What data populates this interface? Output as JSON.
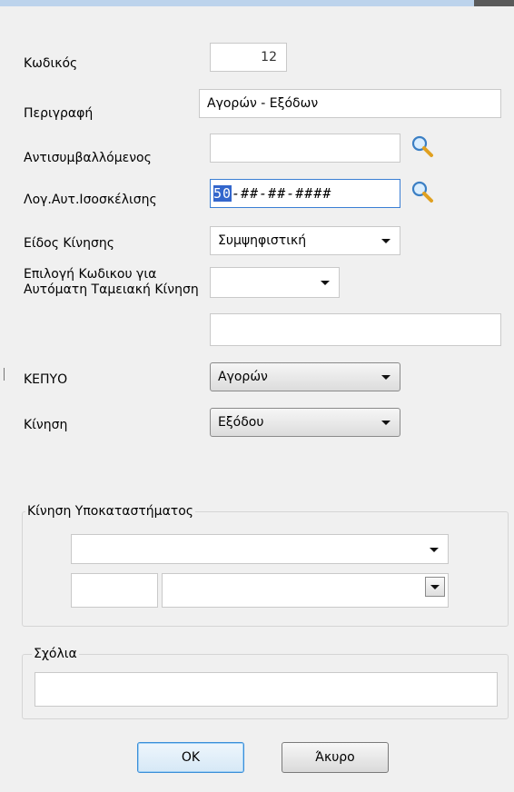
{
  "form": {
    "code_label": "Κωδικός",
    "code_value": "12",
    "description_label": "Περιγραφή",
    "description_value": "Αγορών - Εξόδων",
    "counterparty_label": "Αντισυμβαλλόμενος",
    "counterparty_value": "",
    "balance_account_label": "Λογ.Αυτ.Ισοσκέλισης",
    "balance_account_selected": "50",
    "balance_account_mask": "-##-##-####",
    "movement_type_label": "Είδος Κίνησης",
    "movement_type_value": "Συμψηφιστική",
    "auto_cash_label": "Επιλογή Κωδικου για Αυτόματη Ταμειακή Κίνηση",
    "auto_cash_value": "",
    "auto_cash_text_value": "",
    "kepyo_label": "ΚΕΠΥΟ",
    "kepyo_value": "Αγορών",
    "movement_label": "Κίνηση",
    "movement_value": "Εξόδου"
  },
  "branch_group": {
    "legend": "Κίνηση Υποκαταστήματος",
    "combo_value": "",
    "code_value": "",
    "name_value": ""
  },
  "comments_group": {
    "legend": "Σχόλια",
    "value": ""
  },
  "buttons": {
    "ok": "OK",
    "cancel": "Άκυρο"
  },
  "icons": {
    "search": "search-icon",
    "dropdown": "chevron-down-icon"
  }
}
